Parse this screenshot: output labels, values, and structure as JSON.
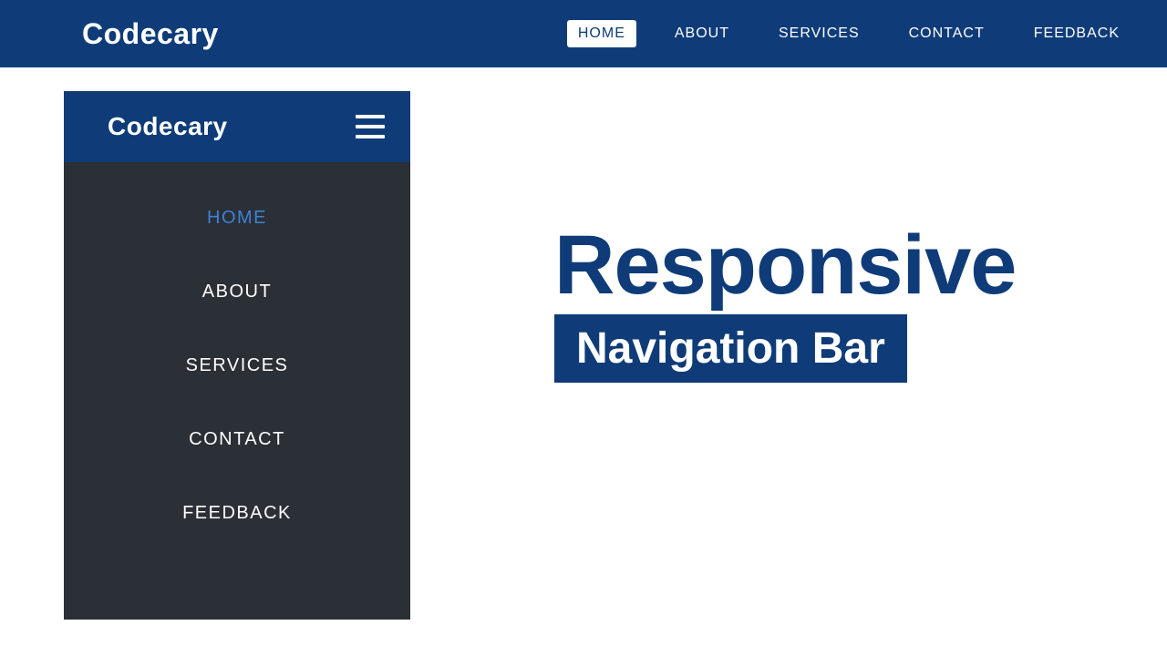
{
  "brand": "Codecary",
  "nav": {
    "items": [
      {
        "label": "HOME",
        "active": true
      },
      {
        "label": "ABOUT",
        "active": false
      },
      {
        "label": "SERVICES",
        "active": false
      },
      {
        "label": "CONTACT",
        "active": false
      },
      {
        "label": "FEEDBACK",
        "active": false
      }
    ]
  },
  "mobile": {
    "brand": "Codecary",
    "items": [
      {
        "label": "HOME",
        "active": true
      },
      {
        "label": "ABOUT",
        "active": false
      },
      {
        "label": "SERVICES",
        "active": false
      },
      {
        "label": "CONTACT",
        "active": false
      },
      {
        "label": "FEEDBACK",
        "active": false
      }
    ]
  },
  "hero": {
    "line1": "Responsive",
    "line2": "Navigation Bar"
  }
}
